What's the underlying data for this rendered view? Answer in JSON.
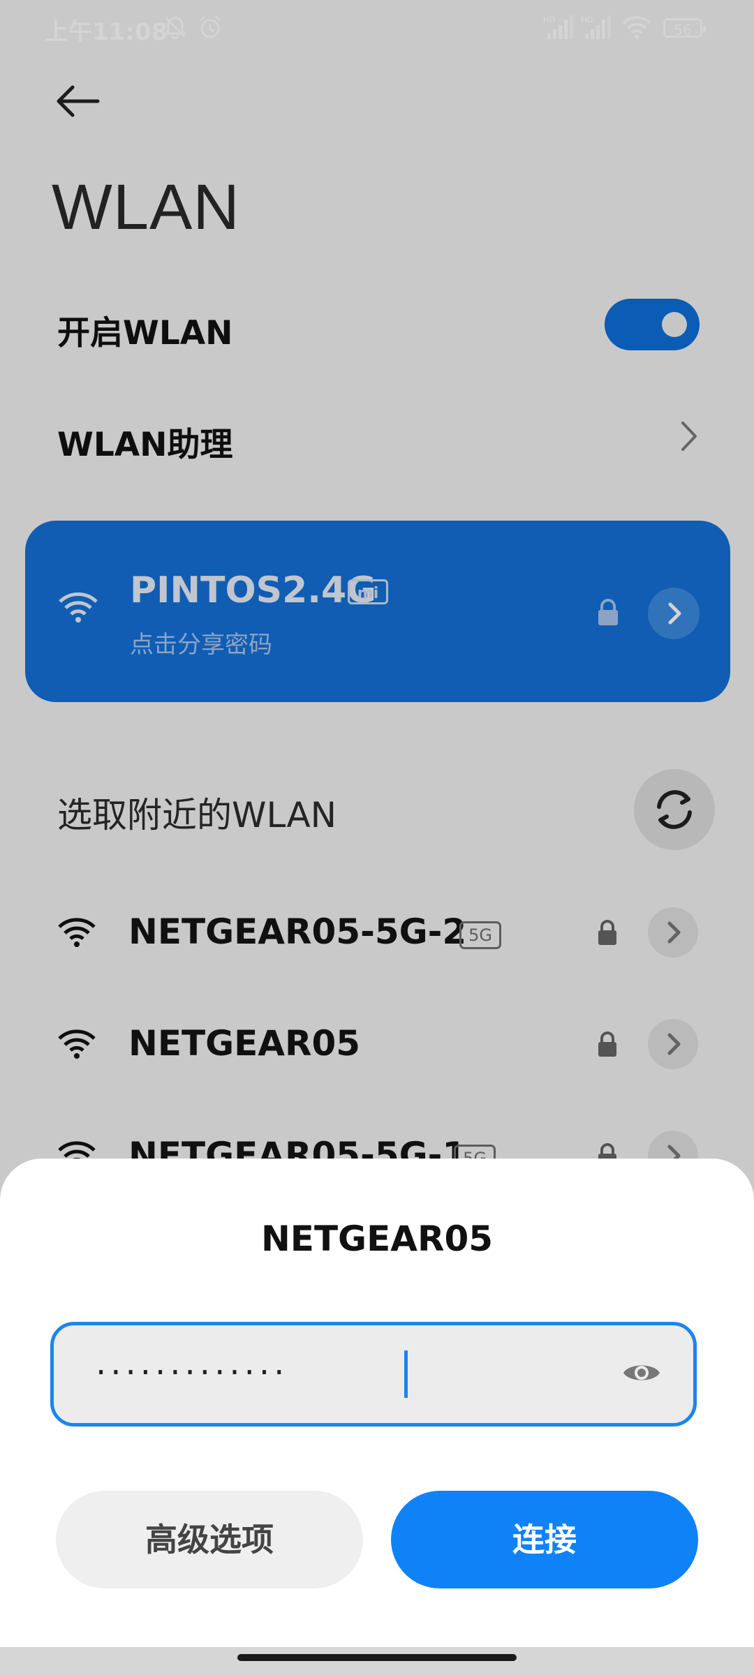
{
  "status_bar": {
    "time": "上午11:08",
    "battery": "56",
    "icons": [
      "bell-off-icon",
      "alarm-icon",
      "hd-signal-icon",
      "hd-signal-icon",
      "wifi-icon",
      "battery-icon"
    ]
  },
  "header": {
    "title": "WLAN"
  },
  "settings": {
    "wlan_toggle_label": "开启WLAN",
    "wlan_enabled": true,
    "assistant_label": "WLAN助理"
  },
  "connected": {
    "ssid": "PINTOS2.4G",
    "badge": "mi",
    "subtitle": "点击分享密码"
  },
  "nearby": {
    "title": "选取附近的WLAN",
    "networks": [
      {
        "ssid": "NETGEAR05-5G-2",
        "badge": "5G",
        "secured": true
      },
      {
        "ssid": "NETGEAR05",
        "badge": "",
        "secured": true
      },
      {
        "ssid": "NETGEAR05-5G-1",
        "badge": "5G",
        "secured": true
      }
    ]
  },
  "dialog": {
    "title": "NETGEAR05",
    "password_masked": "·············",
    "advanced_label": "高级选项",
    "connect_label": "连接"
  },
  "colors": {
    "accent": "#1985f0",
    "card_blue": "#1470d8",
    "connect_button": "#0f82f7"
  }
}
